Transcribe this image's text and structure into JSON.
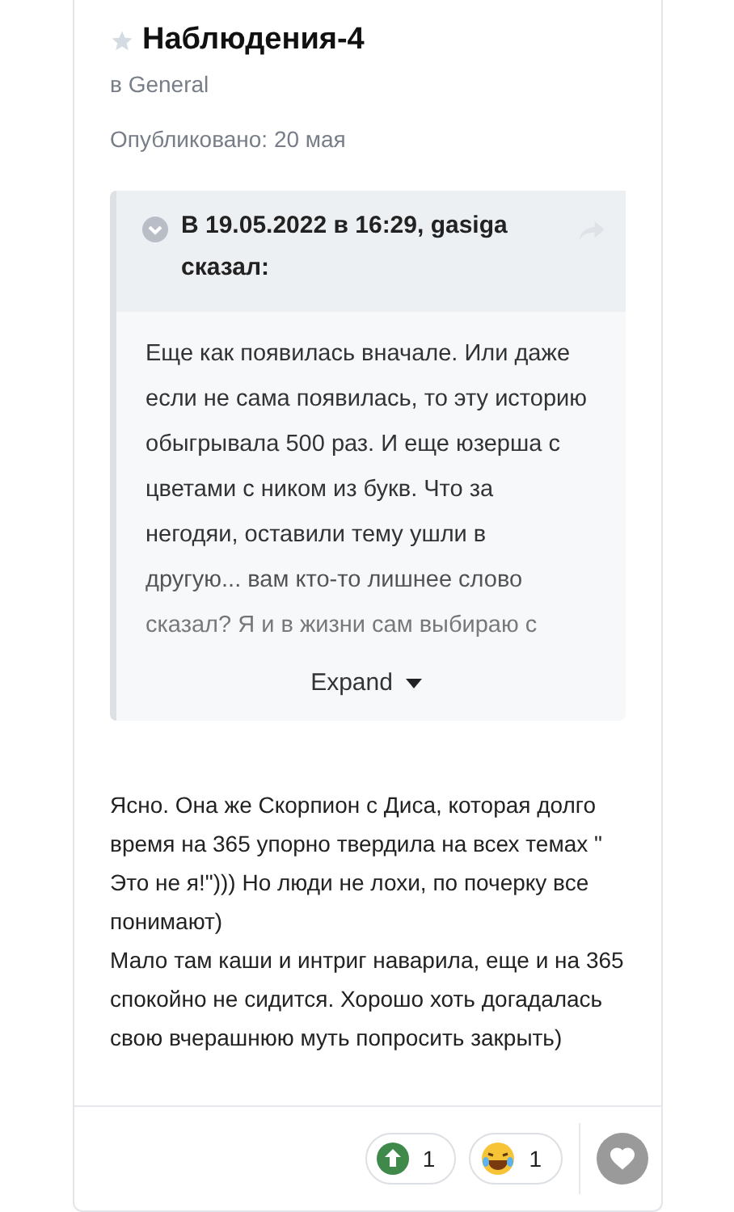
{
  "topic": {
    "title": "Наблюдения-4",
    "starred": false,
    "forum": "в General",
    "published": "Опубликовано: 20 мая"
  },
  "quote": {
    "header": "В 19.05.2022 в 16:29, gasiga сказал:",
    "text": "Еще как появилась вначале. Или даже если не сама появилась, то эту историю обыгрывала 500 раз. И еще юзерша с цветами с ником из букв. Что за негодяи, оставили тему ушли в другую... вам кто-то лишнее слово сказал? Я и в жизни сам выбираю с",
    "expand": "Expand"
  },
  "post": {
    "paragraphs": [
      "Ясно. Она же Скорпион с Диса, которая долго время на 365 упорно твердила на всех темах \" Это не я!\"))) Но люди не лохи, по почерку все понимают)",
      "Мало там каши и интриг наварила, еще и на 365 спокойно не сидится. Хорошо хоть догадалась свою вчерашнюю муть попросить закрыть)"
    ]
  },
  "reactions": [
    {
      "kind": "upvote",
      "count": "1"
    },
    {
      "kind": "laugh",
      "count": "1"
    }
  ]
}
